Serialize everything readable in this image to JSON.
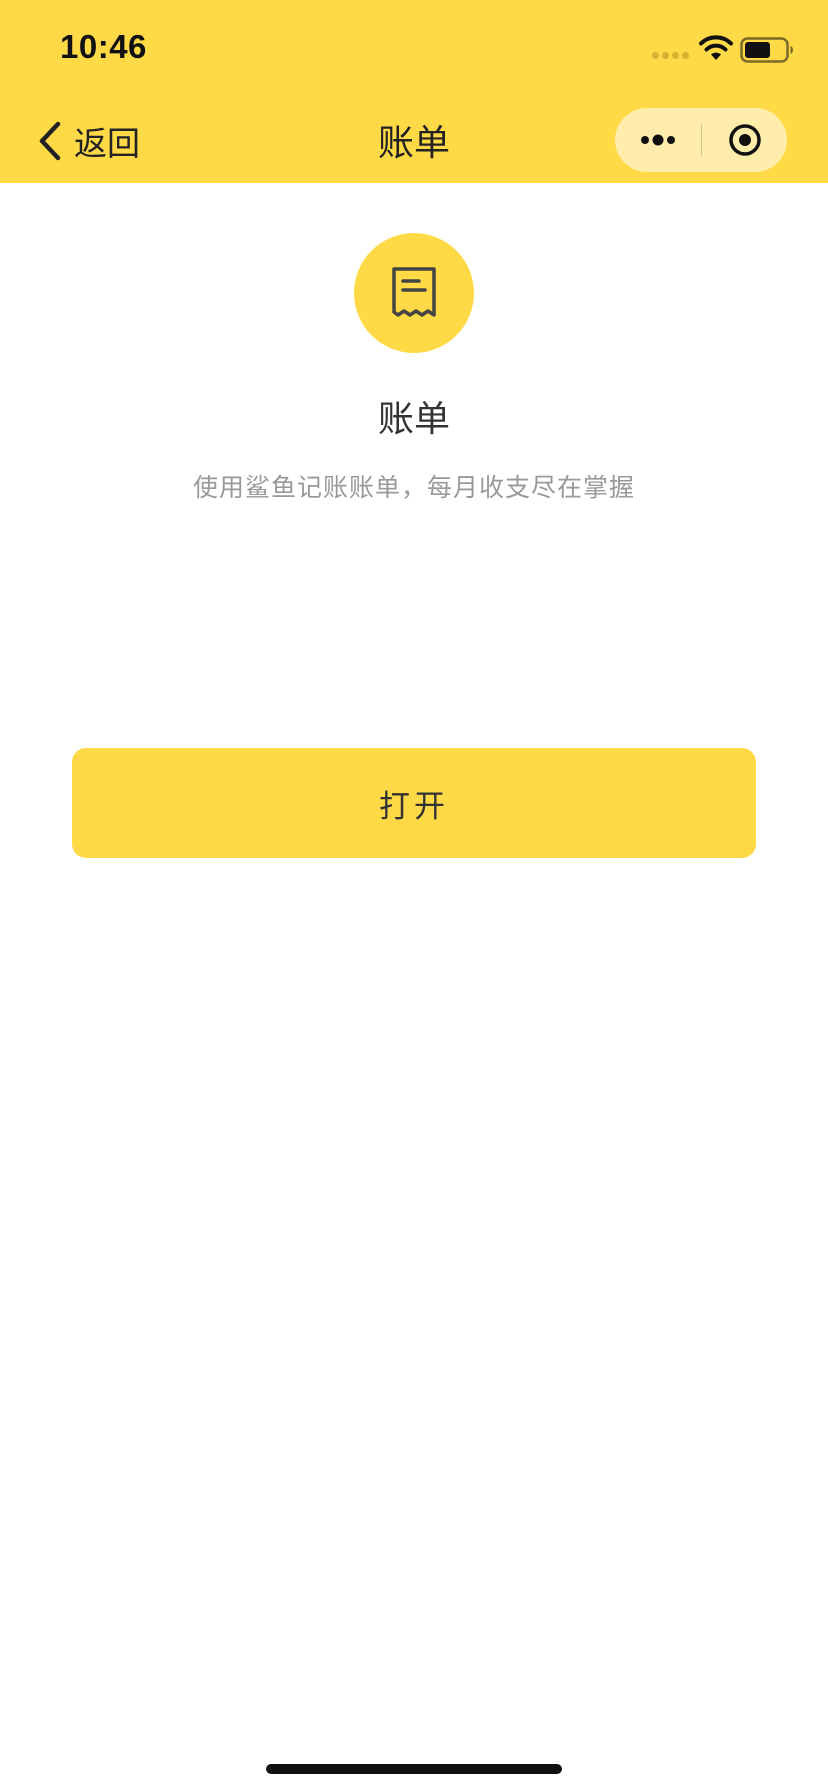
{
  "status_bar": {
    "time": "10:46"
  },
  "nav": {
    "back_label": "返回",
    "title": "账单"
  },
  "hero": {
    "icon": "receipt-icon",
    "title": "账单",
    "description": "使用鲨鱼记账账单，每月收支尽在掌握"
  },
  "actions": {
    "open_label": "打开"
  },
  "colors": {
    "brand_yellow": "#FFD946",
    "title_text": "#333333",
    "muted_text": "#999999"
  },
  "icons": {
    "back": "chevron-left-icon",
    "more": "more-dots-icon",
    "close": "target-close-icon",
    "wifi": "wifi-icon",
    "battery": "battery-icon",
    "signal": "signal-dots-icon"
  }
}
